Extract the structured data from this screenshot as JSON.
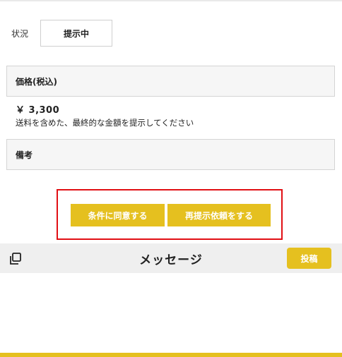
{
  "status": {
    "label": "状況",
    "value": "提示中"
  },
  "price": {
    "header": "価格(税込)",
    "value": "￥ 3,300",
    "note": "送料を含めた、最終的な金額を提示してください"
  },
  "notes": {
    "header": "備考"
  },
  "actions": {
    "agree": "条件に同意する",
    "rerequest": "再提示依頼をする"
  },
  "message_bar": {
    "title": "メッセージ",
    "post_label": "投稿",
    "icon": "copy-icon"
  },
  "colors": {
    "accent": "#e5c01f",
    "highlight": "#e10f14",
    "bar_bg": "#efefef"
  }
}
